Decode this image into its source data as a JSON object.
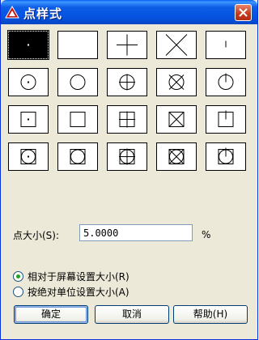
{
  "window": {
    "title": "点样式"
  },
  "point_styles": [
    {
      "name": "dot",
      "selected": true
    },
    {
      "name": "none",
      "selected": false
    },
    {
      "name": "plus",
      "selected": false
    },
    {
      "name": "x",
      "selected": false
    },
    {
      "name": "tick",
      "selected": false
    },
    {
      "name": "circle-dot",
      "selected": false
    },
    {
      "name": "circle",
      "selected": false
    },
    {
      "name": "circle-plus",
      "selected": false
    },
    {
      "name": "circle-x",
      "selected": false
    },
    {
      "name": "circle-tick",
      "selected": false
    },
    {
      "name": "square-dot",
      "selected": false
    },
    {
      "name": "square",
      "selected": false
    },
    {
      "name": "square-plus",
      "selected": false
    },
    {
      "name": "square-x",
      "selected": false
    },
    {
      "name": "square-tick",
      "selected": false
    },
    {
      "name": "square-circle-dot",
      "selected": false
    },
    {
      "name": "square-circle",
      "selected": false
    },
    {
      "name": "square-circle-plus",
      "selected": false
    },
    {
      "name": "square-circle-x",
      "selected": false
    },
    {
      "name": "square-circle-tick",
      "selected": false
    }
  ],
  "size": {
    "label": "点大小(S):",
    "value": "5.0000",
    "unit": "%"
  },
  "radios": [
    {
      "label": "相对于屏幕设置大小(R)",
      "checked": true
    },
    {
      "label": "按绝对单位设置大小(A)",
      "checked": false
    }
  ],
  "buttons": {
    "ok": "确定",
    "cancel": "取消",
    "help": "帮助(H)"
  }
}
